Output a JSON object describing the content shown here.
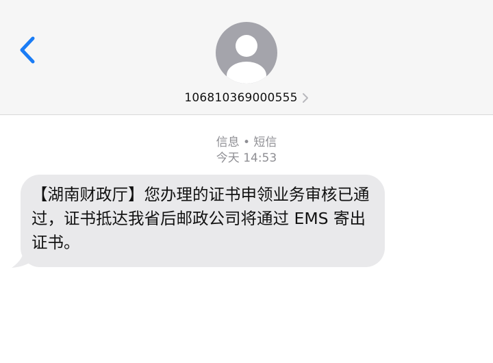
{
  "header": {
    "contact_number": "106810369000555",
    "accent_color": "#1a7cf5",
    "avatar_icon": "person-silhouette-icon",
    "back_icon": "chevron-left-icon",
    "detail_icon": "chevron-right-icon"
  },
  "conversation": {
    "service_label": "信息 • 短信",
    "timestamp": "今天 14:53",
    "messages": [
      {
        "direction": "incoming",
        "text": "【湖南财政厅】您办理的证书申领业务审核已通过，证书抵达我省后邮政公司将通过 EMS 寄出证书。"
      }
    ]
  }
}
